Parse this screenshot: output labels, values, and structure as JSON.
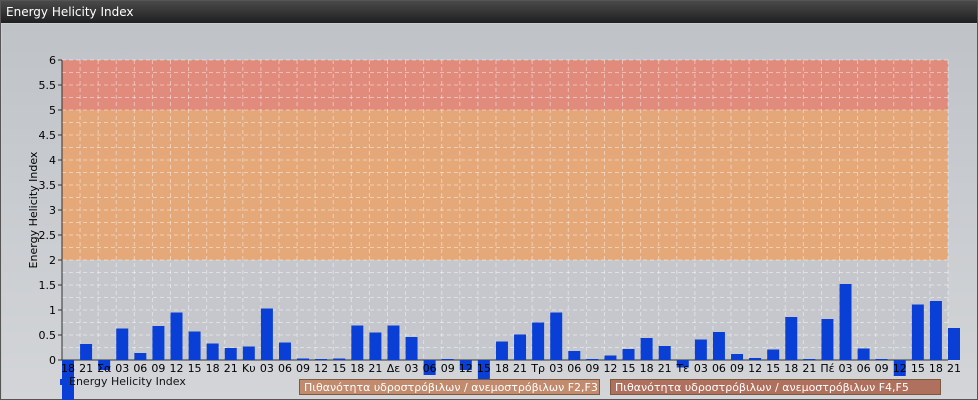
{
  "window": {
    "title": "Energy Helicity Index"
  },
  "colors": {
    "bar": "#0a3fd6",
    "band_high": "#e28877",
    "band_mid": "#e6a574",
    "band_low": "#c3c6ca",
    "legend_f2f3": "#c28b6e",
    "legend_f4f5": "#b0705e"
  },
  "legend": {
    "series_label": "Energy Helicity Index",
    "f2f3_label": "Πιθανότητα υδροστρόβιλων / ανεμοστρόβιλων F2,F3",
    "f4f5_label": "Πιθανότητα υδροστρόβιλων / ανεμοστρόβιλων F4,F5"
  },
  "chart_data": {
    "type": "bar",
    "title": "",
    "ylabel": "Energy Helicity Index",
    "xlabel": "",
    "ylim": [
      0,
      6
    ],
    "yticks": [
      "0",
      "0.5",
      "1",
      "1.5",
      "2",
      "2.5",
      "3",
      "3.5",
      "4",
      "4.5",
      "5",
      "5.5",
      "6"
    ],
    "bands": [
      {
        "from": 2,
        "to": 5,
        "label": "Πιθανότητα υδροστρόβιλων / ανεμοστρόβιλων F2,F3"
      },
      {
        "from": 5,
        "to": 6,
        "label": "Πιθανότητα υδροστρόβιλων / ανεμοστρόβιλων F4,F5"
      }
    ],
    "grid": true,
    "categories": [
      "18",
      "21",
      "Σα",
      "03",
      "06",
      "09",
      "12",
      "15",
      "18",
      "21",
      "Κυ",
      "03",
      "06",
      "09",
      "12",
      "15",
      "18",
      "21",
      "Δε",
      "03",
      "06",
      "09",
      "12",
      "15",
      "18",
      "21",
      "Τρ",
      "03",
      "06",
      "09",
      "12",
      "15",
      "18",
      "21",
      "Τε",
      "03",
      "06",
      "09",
      "12",
      "15",
      "18",
      "21",
      "Πέ",
      "03",
      "06",
      "09",
      "12",
      "15",
      "18",
      "21"
    ],
    "series": [
      {
        "values": [
          -0.8,
          0.32,
          -0.2,
          0.63,
          0.14,
          0.68,
          0.95,
          0.57,
          0.33,
          0.24,
          0.27,
          1.03,
          0.35,
          0.03,
          0.02,
          0.03,
          0.69,
          0.55,
          0.69,
          0.46,
          -0.3,
          0.02,
          -0.2,
          -0.7,
          0.37,
          0.51,
          0.75,
          0.95,
          0.18,
          0.02,
          0.09,
          0.22,
          0.44,
          0.28,
          -0.15,
          0.41,
          0.56,
          0.12,
          0.04,
          0.21,
          0.86,
          0.02,
          0.82,
          1.52,
          0.23,
          0.02,
          -0.32,
          1.11,
          1.18,
          0.64
        ]
      }
    ]
  }
}
